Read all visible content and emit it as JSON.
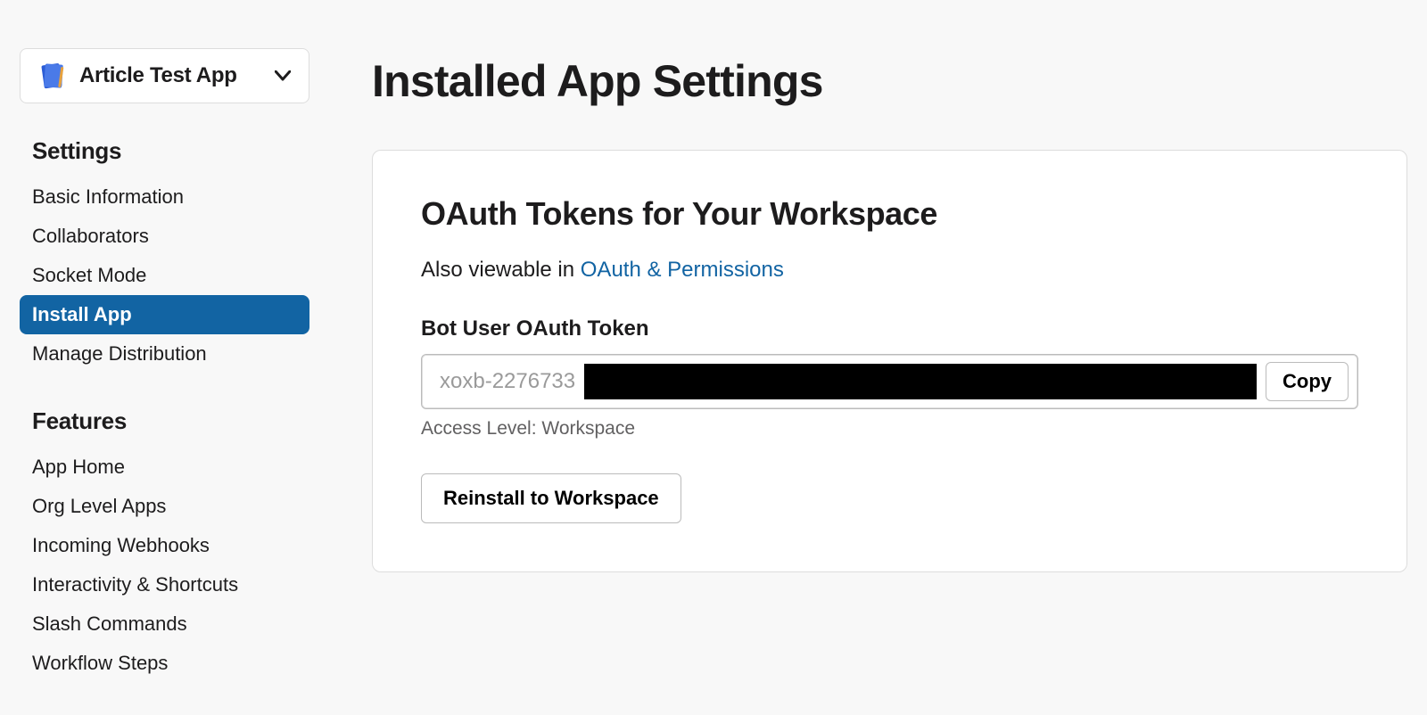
{
  "app_selector": {
    "name": "Article Test App"
  },
  "sidebar": {
    "sections": [
      {
        "title": "Settings",
        "items": [
          {
            "label": "Basic Information",
            "active": false
          },
          {
            "label": "Collaborators",
            "active": false
          },
          {
            "label": "Socket Mode",
            "active": false
          },
          {
            "label": "Install App",
            "active": true
          },
          {
            "label": "Manage Distribution",
            "active": false
          }
        ]
      },
      {
        "title": "Features",
        "items": [
          {
            "label": "App Home",
            "active": false
          },
          {
            "label": "Org Level Apps",
            "active": false
          },
          {
            "label": "Incoming Webhooks",
            "active": false
          },
          {
            "label": "Interactivity & Shortcuts",
            "active": false
          },
          {
            "label": "Slash Commands",
            "active": false
          },
          {
            "label": "Workflow Steps",
            "active": false
          }
        ]
      }
    ]
  },
  "main": {
    "page_title": "Installed App Settings",
    "card_title": "OAuth Tokens for Your Workspace",
    "subtitle_prefix": "Also viewable in ",
    "subtitle_link": "OAuth & Permissions",
    "token_label": "Bot User OAuth Token",
    "token_prefix": "xoxb-2276733",
    "copy_label": "Copy",
    "access_level": "Access Level: Workspace",
    "reinstall_label": "Reinstall to Workspace"
  }
}
